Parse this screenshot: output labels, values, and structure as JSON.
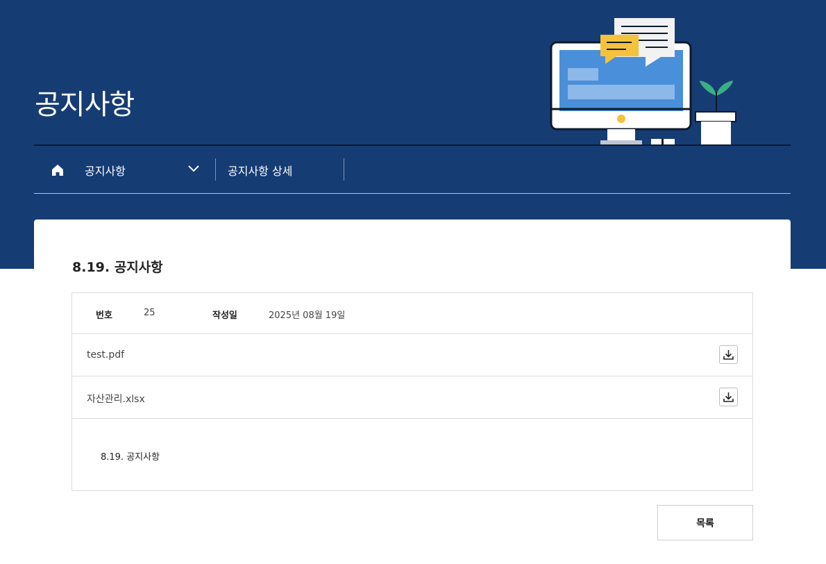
{
  "header": {
    "title": "공지사항"
  },
  "breadcrumb": {
    "items": [
      "공지사항",
      "공지사항 상세"
    ]
  },
  "post": {
    "title": "8.19. 공지사항",
    "number_label": "번호",
    "number_value": "25",
    "date_label": "작성일",
    "date_value": "2025년 08월 19일",
    "files": [
      {
        "name": "test.pdf"
      },
      {
        "name": "자산관리.xlsx"
      }
    ],
    "content": "8.19. 공지사항"
  },
  "actions": {
    "list_label": "목록"
  },
  "icons": {
    "home": "home-icon",
    "chevron": "chevron-down-icon",
    "download": "download-icon"
  },
  "colors": {
    "hero_bg": "#163c74",
    "monitor_screen": "#4a8fd9",
    "speech_yellow": "#f4c23c",
    "plant_green": "#3cae85"
  }
}
